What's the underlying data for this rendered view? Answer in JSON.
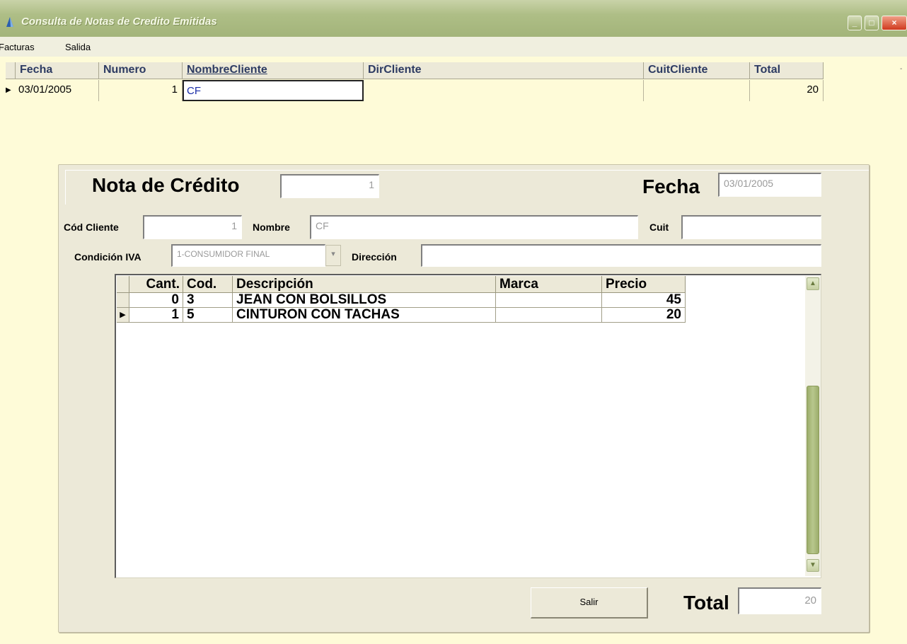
{
  "window": {
    "title": "Consulta de Notas de Credito Emitidas",
    "icon": "app-icon",
    "controls": [
      "minimize-icon",
      "maximize-icon",
      "close-icon"
    ]
  },
  "menu": {
    "items": [
      {
        "label": "Facturas"
      },
      {
        "label": "Salida"
      }
    ]
  },
  "top_grid": {
    "columns": [
      "Fecha",
      "Numero",
      "NombreCliente",
      "DirCliente",
      "CuitCliente",
      "Total"
    ],
    "rows": [
      {
        "fecha": "03/01/2005",
        "numero": "1",
        "nombre": "CF",
        "dir": "",
        "cuit": "",
        "total": "20"
      }
    ]
  },
  "form": {
    "title_label": "Nota de Crédito",
    "numero_value": "1",
    "fecha_label": "Fecha",
    "fecha_value": "03/01/2005",
    "cod_cliente_label": "Cód Cliente",
    "cod_cliente_value": "1",
    "nombre_label": "Nombre",
    "nombre_value": "CF",
    "cuit_label": "Cuit",
    "cuit_value": "",
    "condicion_label": "Condición IVA",
    "condicion_value": "1-CONSUMIDOR FINAL",
    "direccion_label": "Dirección",
    "direccion_value": ""
  },
  "detail_grid": {
    "columns": [
      "Cant.",
      "Cod.",
      "Descripción",
      "Marca",
      "Precio"
    ],
    "rows": [
      {
        "cant": "0",
        "cod": "3",
        "descripcion": "JEAN CON BOLSILLOS",
        "marca": "",
        "precio": "45"
      },
      {
        "cant": "1",
        "cod": "5",
        "descripcion": "CINTURON CON TACHAS",
        "marca": "",
        "precio": "20"
      }
    ]
  },
  "footer": {
    "salir_label": "Salir",
    "total_label": "Total",
    "total_value": "20"
  },
  "colors": {
    "titlebar": "#a3b47a",
    "background": "#fefbd8",
    "panel": "#ece9d8"
  }
}
